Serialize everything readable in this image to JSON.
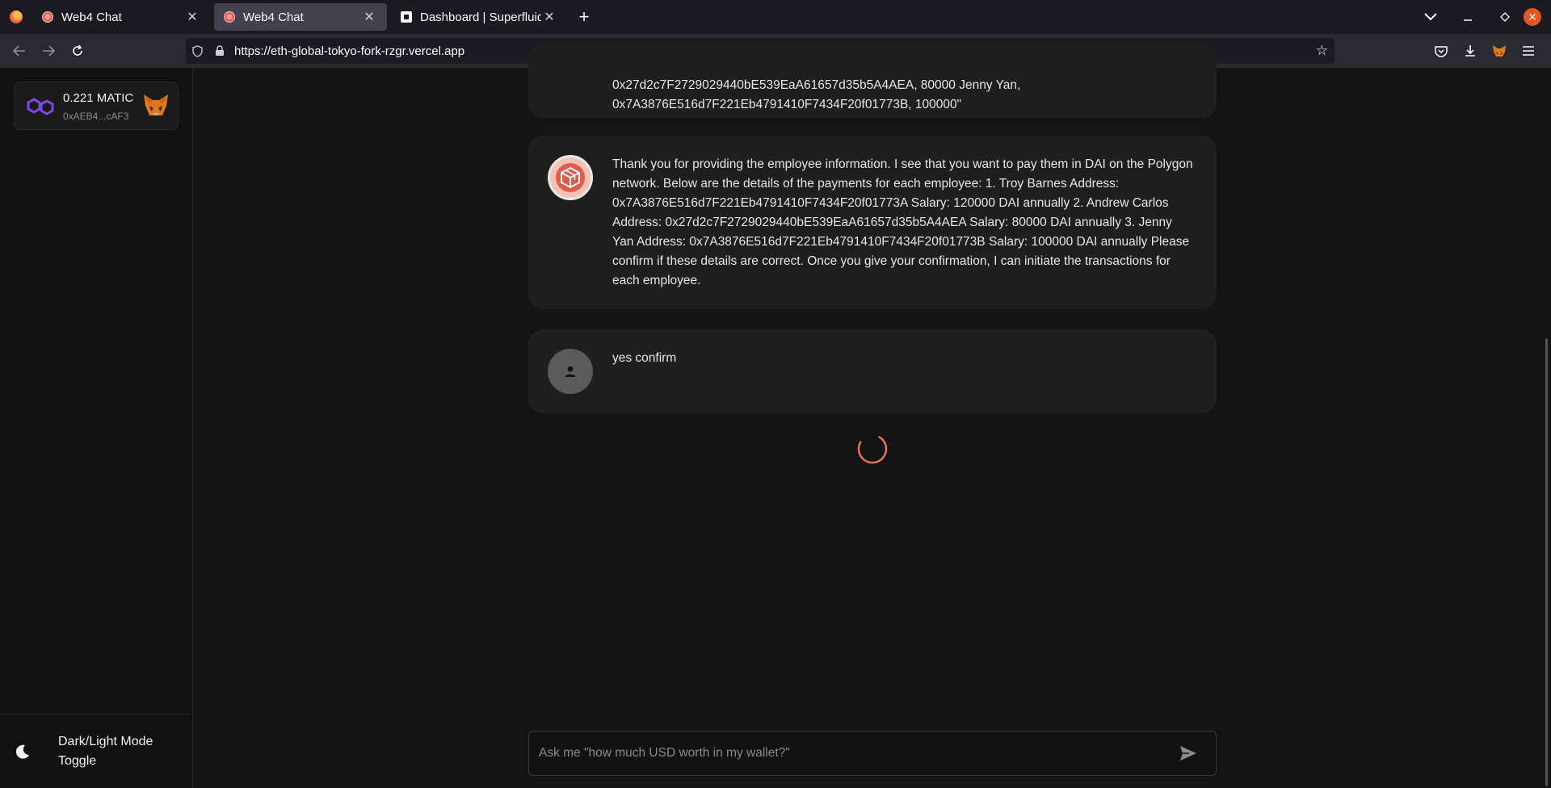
{
  "browser": {
    "tabs": [
      {
        "title": "Web4 Chat",
        "favicon": "web4-favicon-icon",
        "active": false
      },
      {
        "title": "Web4 Chat",
        "favicon": "web4-favicon-icon",
        "active": true
      },
      {
        "title": "Dashboard | Superfluid",
        "favicon": "superfluid-favicon-icon",
        "active": false
      }
    ],
    "url_host": "https://eth-global-tokyo-fork-rzgr.vercel.app"
  },
  "sidebar": {
    "wallet": {
      "balance": "0.221 MATIC",
      "address": "0xAEB4...cAF3",
      "network_icon": "polygon-icon",
      "wallet_icon": "metamask-fox-icon"
    },
    "mode_toggle_label": "Dark/Light Mode Toggle"
  },
  "chat": {
    "messages": [
      {
        "role": "user",
        "text": "0x27d2c7F2729029440bE539EaA61657d35b5A4AEA, 80000 Jenny Yan, 0x7A3876E516d7F221Eb4791410F7434F20f01773B, 100000\""
      },
      {
        "role": "assistant",
        "text": "Thank you for providing the employee information. I see that you want to pay them in DAI on the Polygon network. Below are the details of the payments for each employee: 1. Troy Barnes Address: 0x7A3876E516d7F221Eb4791410F7434F20f01773A Salary: 120000 DAI annually 2. Andrew Carlos Address: 0x27d2c7F2729029440bE539EaA61657d35b5A4AEA Salary: 80000 DAI annually 3. Jenny Yan Address: 0x7A3876E516d7F221Eb4791410F7434F20f01773B Salary: 100000 DAI annually Please confirm if these details are correct. Once you give your confirmation, I can initiate the transactions for each employee."
      },
      {
        "role": "user",
        "text": "yes confirm"
      }
    ],
    "loading": true,
    "input_placeholder": "Ask me \"how much USD worth in my wallet?\"",
    "input_value": ""
  },
  "colors": {
    "accent_spinner": "#e8705f",
    "polygon_purple": "#8247e5",
    "firefox_close": "#e9541f"
  }
}
